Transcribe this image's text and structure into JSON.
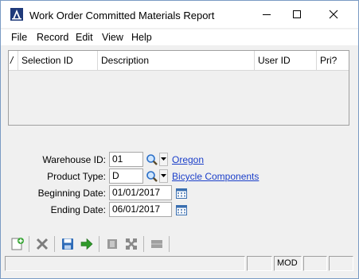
{
  "window": {
    "title": "Work Order Committed Materials Report"
  },
  "menu": [
    "File",
    "Record",
    "Edit",
    "View",
    "Help"
  ],
  "grid": {
    "columns": [
      "Selection ID",
      "Description",
      "User ID",
      "Pri?"
    ],
    "marker": "/"
  },
  "form": {
    "warehouse": {
      "label": "Warehouse ID:",
      "value": "01",
      "link": "Oregon"
    },
    "product_type": {
      "label": "Product Type:",
      "value": "D",
      "link": "Bicycle Components"
    },
    "beginning_date": {
      "label": "Beginning Date:",
      "value": "01/01/2017"
    },
    "ending_date": {
      "label": "Ending Date:",
      "value": "06/01/2017"
    }
  },
  "status": {
    "mode": "MOD"
  },
  "colors": {
    "link": "#1a3ec9",
    "window_border": "#7a9bc4",
    "background": "#f0f0f0"
  },
  "icons": [
    "app-logo-icon",
    "minimize-icon",
    "maximize-icon",
    "close-icon",
    "search-icon",
    "dropdown-arrow-icon",
    "calendar-icon",
    "new-record-icon",
    "delete-icon",
    "save-icon",
    "run-report-icon",
    "copy-icon",
    "collapse-icon",
    "list-icon"
  ]
}
